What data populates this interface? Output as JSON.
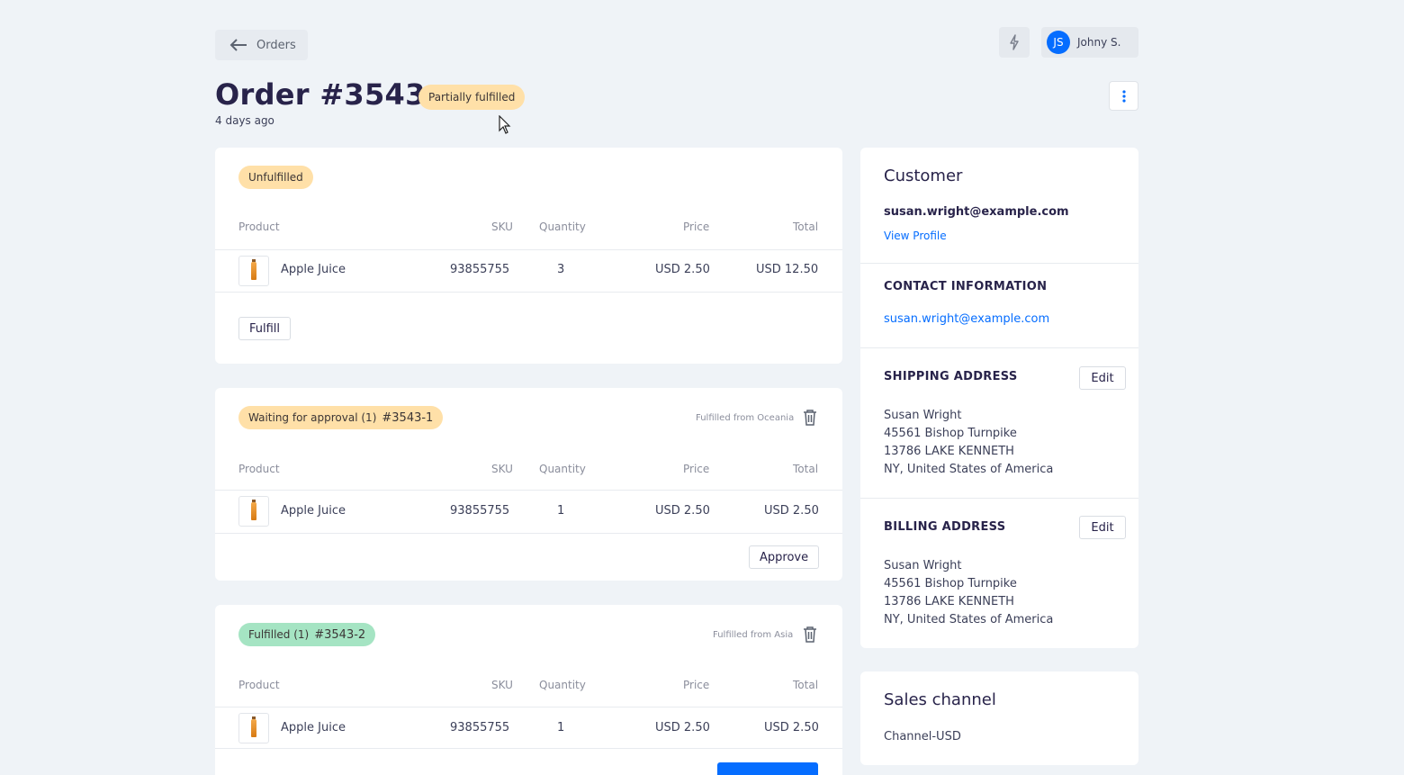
{
  "nav": {
    "back_label": "Orders"
  },
  "user": {
    "initials": "JS",
    "name": "Johny S."
  },
  "order": {
    "title": "Order #3543",
    "status": "Partially fulfilled",
    "age": "4 days ago"
  },
  "columns": {
    "product": "Product",
    "sku": "SKU",
    "quantity": "Quantity",
    "price": "Price",
    "total": "Total"
  },
  "unfulfilled": {
    "badge": "Unfulfilled",
    "line": {
      "product": "Apple Juice",
      "sku": "93855755",
      "quantity": "3",
      "price": "USD 2.50",
      "total": "USD 12.50"
    },
    "action": "Fulfill"
  },
  "waiting": {
    "badge": "Waiting for approval (1)",
    "number": "#3543-1",
    "source": "Fulfilled from Oceania",
    "line": {
      "product": "Apple Juice",
      "sku": "93855755",
      "quantity": "1",
      "price": "USD 2.50",
      "total": "USD 2.50"
    },
    "action": "Approve"
  },
  "fulfilled": {
    "badge": "Fulfilled (1)",
    "number": "#3543-2",
    "source": "Fulfilled from Asia",
    "line": {
      "product": "Apple Juice",
      "sku": "93855755",
      "quantity": "1",
      "price": "USD 2.50",
      "total": "USD 2.50"
    }
  },
  "customer": {
    "title": "Customer",
    "email": "susan.wright@example.com",
    "view_profile": "View Profile",
    "contact_label": "CONTACT INFORMATION",
    "contact_email": "susan.wright@example.com",
    "shipping_label": "SHIPPING ADDRESS",
    "shipping": [
      "Susan Wright",
      "45561 Bishop Turnpike",
      "13786 LAKE KENNETH",
      "NY, United States of America"
    ],
    "billing_label": "BILLING ADDRESS",
    "billing": [
      "Susan Wright",
      "45561 Bishop Turnpike",
      "13786 LAKE KENNETH",
      "NY, United States of America"
    ],
    "edit_label": "Edit"
  },
  "sales_channel": {
    "title": "Sales channel",
    "value": "Channel-USD"
  },
  "colors": {
    "accent": "#056dff",
    "warning_pill": "#ffe0a8",
    "success_pill": "#a5e4c3",
    "background": "#eff3f7"
  },
  "icons": [
    "arrow-left-icon",
    "bolt-icon",
    "kebab-menu-icon",
    "trash-icon",
    "product-thumbnail"
  ]
}
